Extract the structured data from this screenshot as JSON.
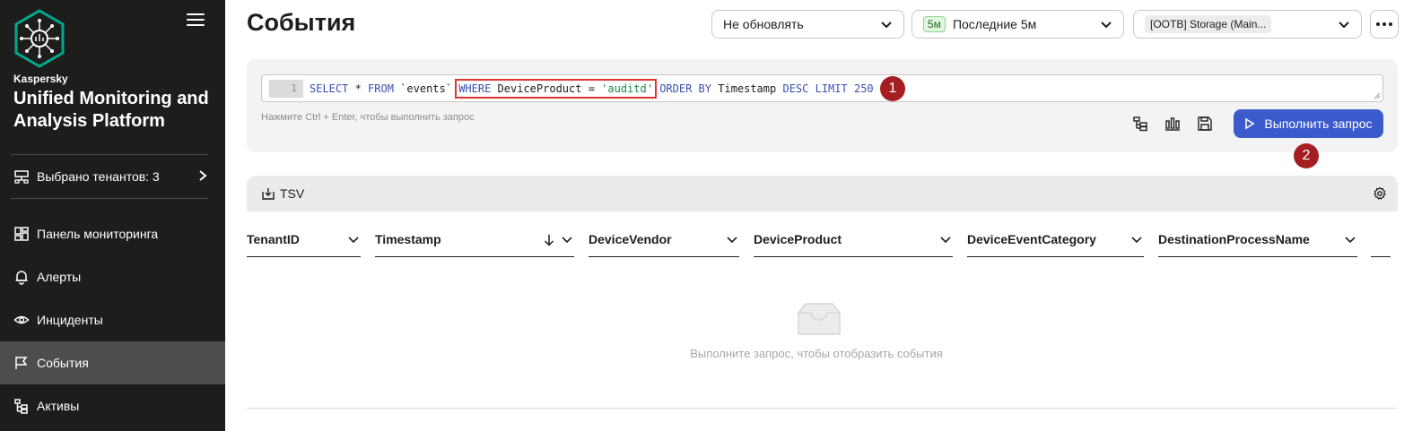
{
  "sidebar": {
    "brand_small": "Kaspersky",
    "brand_big": "Unified Monitoring and Analysis Platform",
    "tenants_label": "Выбрано тенантов: 3",
    "items": [
      {
        "label": "Панель мониторинга",
        "icon": "dashboard-icon"
      },
      {
        "label": "Алерты",
        "icon": "bell-icon"
      },
      {
        "label": "Инциденты",
        "icon": "eye-icon"
      },
      {
        "label": "События",
        "icon": "flag-icon",
        "active": true
      },
      {
        "label": "Активы",
        "icon": "assets-icon"
      }
    ]
  },
  "header": {
    "title": "События",
    "refresh_select": "Не обновлять",
    "period_badge": "5м",
    "period_select": "Последние 5м",
    "storage_select": "[OOTB] Storage (Main..."
  },
  "query": {
    "line_number": "1",
    "parts": {
      "select": "SELECT",
      "star_from": " * ",
      "from": "FROM",
      "table": " `events` ",
      "where": "WHERE",
      "where_field": " DeviceProduct = ",
      "where_value": "'auditd'",
      "order": "ORDER BY",
      "order_field": " Timestamp ",
      "desc": "DESC",
      "limit": "LIMIT",
      "limit_value": "250"
    },
    "hint": "Нажмите Ctrl + Enter, чтобы выполнить запрос",
    "run_label": "Выполнить запрос"
  },
  "markers": [
    "1",
    "2"
  ],
  "results": {
    "export_label": "TSV",
    "columns": [
      "TenantID",
      "Timestamp",
      "DeviceVendor",
      "DeviceProduct",
      "DeviceEventCategory",
      "DestinationProcessName"
    ],
    "empty_text": "Выполните запрос, чтобы отобразить события"
  },
  "colors": {
    "sidebar_bg": "#1d1d1b",
    "accent": "#3b5bcc",
    "marker": "#a31d21",
    "highlight": "#e03333"
  }
}
